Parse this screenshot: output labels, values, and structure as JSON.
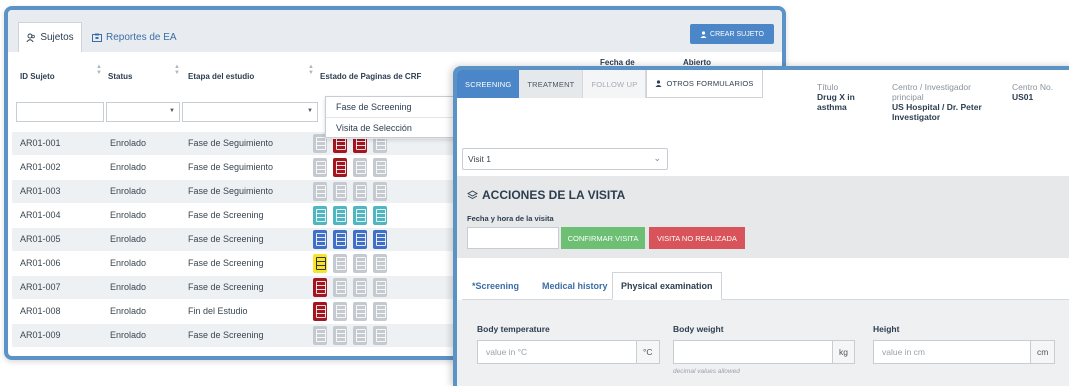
{
  "back": {
    "tabs": {
      "sujetos": "Sujetos",
      "reportes": "Reportes de EA"
    },
    "crear_button": "CREAR SUJETO",
    "headers": {
      "id": "ID Sujeto",
      "status": "Status",
      "etapa": "Etapa del estudio",
      "estado": "Estado de Paginas de CRF",
      "fecha": "Fecha de",
      "abierto": "Abierto"
    },
    "dropdown_options": [
      "Fase de Screening",
      "Visita de Selección"
    ],
    "rows": [
      {
        "id": "AR01-001",
        "status": "Enrolado",
        "etapa": "Fase de Seguimiento",
        "docs": [
          "#c5cad0",
          "#a3161f",
          "#a3161f",
          "#c5cad0"
        ]
      },
      {
        "id": "AR01-002",
        "status": "Enrolado",
        "etapa": "Fase de Seguimiento",
        "docs": [
          "#c5cad0",
          "#a3161f",
          "#c5cad0",
          "#c5cad0"
        ]
      },
      {
        "id": "AR01-003",
        "status": "Enrolado",
        "etapa": "Fase de Seguimiento",
        "docs": [
          "#c5cad0",
          "#c5cad0",
          "#c5cad0",
          "#c5cad0"
        ]
      },
      {
        "id": "AR01-004",
        "status": "Enrolado",
        "etapa": "Fase de Screening",
        "docs": [
          "#4fb6c2",
          "#4fb6c2",
          "#4fb6c2",
          "#4fb6c2"
        ]
      },
      {
        "id": "AR01-005",
        "status": "Enrolado",
        "etapa": "Fase de Screening",
        "docs": [
          "#3f6fc6",
          "#3f6fc6",
          "#3f6fc6",
          "#3f6fc6"
        ]
      },
      {
        "id": "AR01-006",
        "status": "Enrolado",
        "etapa": "Fase de Screening",
        "docs": [
          "#f6e52a",
          "#c5cad0",
          "#c5cad0",
          "#c5cad0"
        ]
      },
      {
        "id": "AR01-007",
        "status": "Enrolado",
        "etapa": "Fase de Screening",
        "docs": [
          "#a3161f",
          "#c5cad0",
          "#c5cad0",
          "#c5cad0"
        ]
      },
      {
        "id": "AR01-008",
        "status": "Enrolado",
        "etapa": "Fin del Estudio",
        "docs": [
          "#a3161f",
          "#c5cad0",
          "#c5cad0",
          "#c5cad0"
        ]
      },
      {
        "id": "AR01-009",
        "status": "Enrolado",
        "etapa": "Fase de Screening",
        "docs": [
          "#c5cad0",
          "#c5cad0",
          "#c5cad0",
          "#c5cad0"
        ]
      }
    ]
  },
  "front": {
    "tabs": [
      "SCREENING",
      "TREATMENT",
      "FOLLOW UP",
      "OTROS FORMULARIOS"
    ],
    "titulo_label": "Título",
    "titulo_value": "Drug X in asthma",
    "centro_label": "Centro / Investigador principal",
    "centro_value": "US Hospital / Dr. Peter Investigator",
    "centro_no_label": "Centro No.",
    "centro_no_value": "US01",
    "visit_select": "Visit 1",
    "acciones_title": "ACCIONES DE LA VISITA",
    "fecha_label": "Fecha y hora de la visita",
    "confirmar_button": "CONFIRMAR VISITA",
    "no_realizada_button": "VISITA NO REALIZADA",
    "content_tabs": [
      "*Screening",
      "Medical history",
      "Physical examination"
    ],
    "fields": {
      "temp_label": "Body temperature",
      "temp_placeholder": "value in °C",
      "temp_unit": "°C",
      "weight_label": "Body weight",
      "weight_unit": "kg",
      "weight_hint": "decimal values allowed",
      "height_label": "Height",
      "height_placeholder": "value in cm",
      "height_unit": "cm"
    }
  }
}
